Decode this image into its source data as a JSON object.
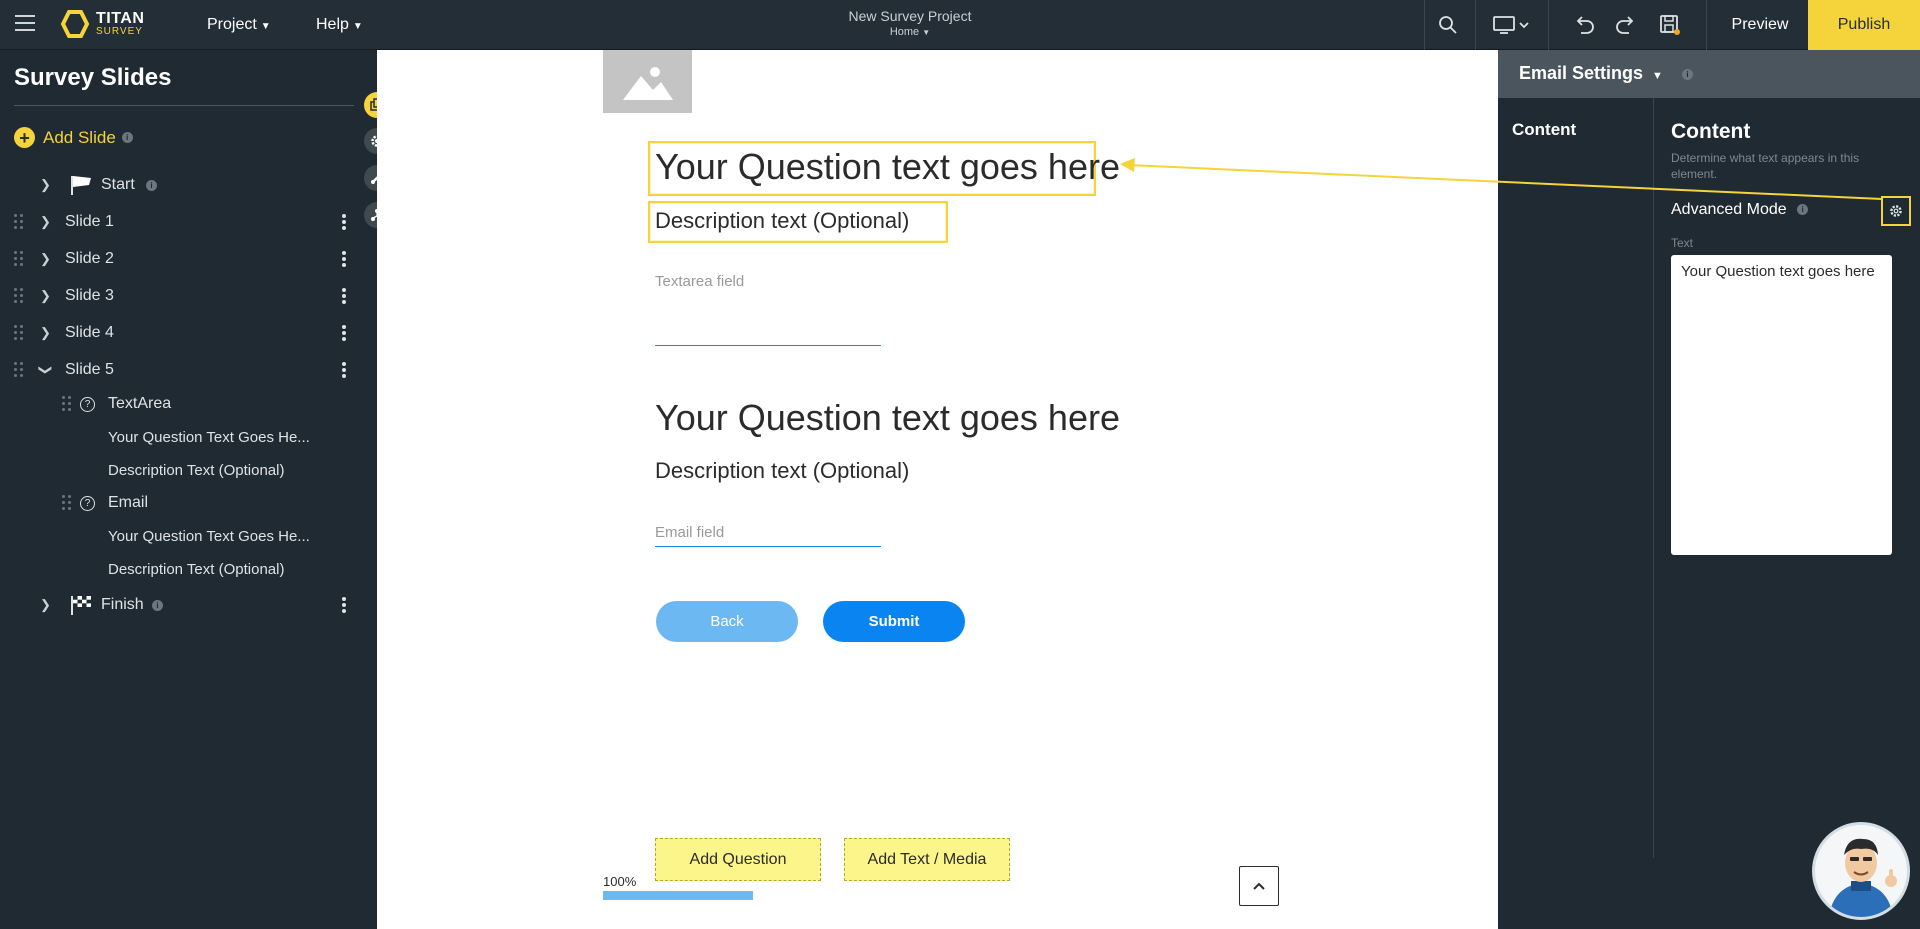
{
  "app": {
    "logo_title": "TITAN",
    "logo_sub": "SURVEY",
    "menu": [
      "Project",
      "Help"
    ],
    "project_title": "New Survey Project",
    "project_sub": "Home",
    "preview_label": "Preview",
    "publish_label": "Publish"
  },
  "sidebar": {
    "title": "Survey Slides",
    "add_slide_label": "Add Slide",
    "tree": {
      "start": "Start",
      "slide1": "Slide 1",
      "slide2": "Slide 2",
      "slide3": "Slide 3",
      "slide4": "Slide 4",
      "slide5": "Slide 5",
      "textarea": "TextArea",
      "textarea_q": "Your Question Text Goes He...",
      "textarea_desc": "Description Text (Optional)",
      "email": "Email",
      "email_q": "Your Question Text Goes He...",
      "email_desc": "Description Text (Optional)",
      "finish": "Finish"
    }
  },
  "canvas": {
    "q1_title": "Your Question text goes here",
    "q1_desc": "Description text (Optional)",
    "q1_placeholder": "Textarea field",
    "q2_title": "Your Question text goes here",
    "q2_desc": "Description text (Optional)",
    "q2_placeholder": "Email field",
    "back_label": "Back",
    "submit_label": "Submit",
    "add_question_label": "Add Question",
    "add_media_label": "Add Text / Media",
    "progress_label": "100%",
    "progress_value": 100
  },
  "panel": {
    "header_title": "Email Settings",
    "nav_content": "Content",
    "content_title": "Content",
    "content_desc": "Determine what text appears in this element.",
    "advanced_mode_label": "Advanced Mode",
    "text_label": "Text",
    "text_value": "Your Question text goes here"
  },
  "colors": {
    "accent": "#f5d33a",
    "primary_button": "#0a84f0",
    "secondary_button": "#6cb8f3",
    "dark_bg": "#1f2a32"
  }
}
